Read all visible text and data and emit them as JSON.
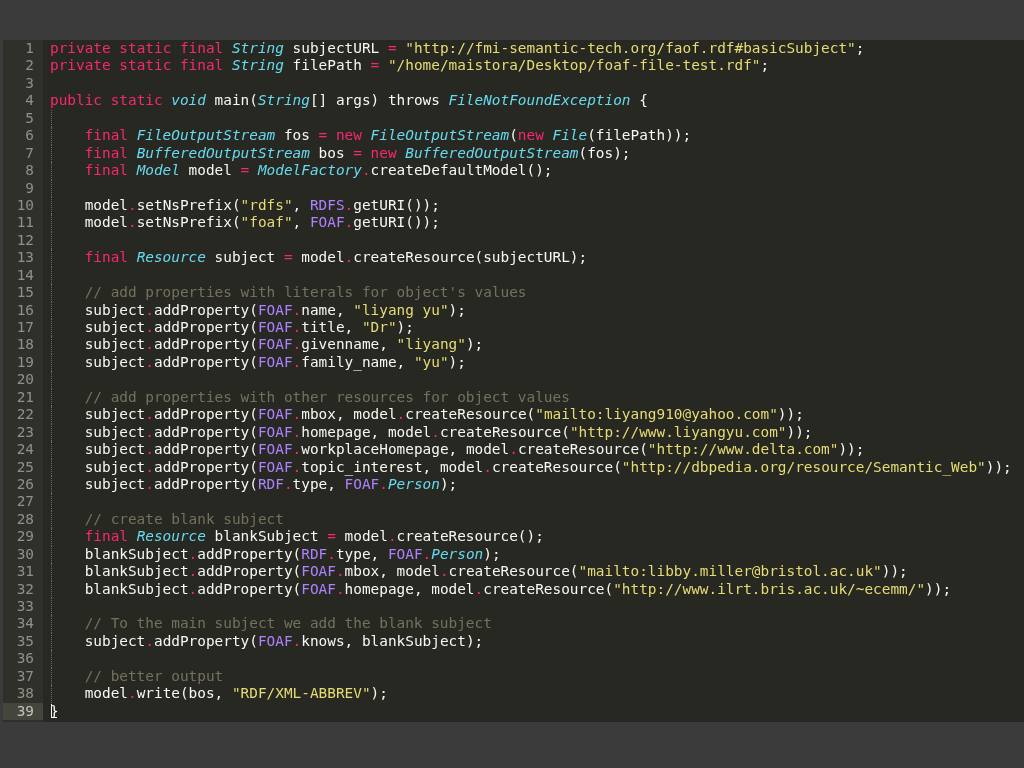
{
  "editor": {
    "lines": [
      {
        "number": "1",
        "indented": false,
        "current": false,
        "tokens": [
          {
            "kind": "keyword",
            "text": "private static final "
          },
          {
            "kind": "type",
            "text": "String"
          },
          {
            "kind": "plain",
            "text": " subjectURL "
          },
          {
            "kind": "operator",
            "text": "= "
          },
          {
            "kind": "string",
            "text": "\"http://fmi-semantic-tech.org/faof.rdf#basicSubject\""
          },
          {
            "kind": "plain",
            "text": ";"
          }
        ]
      },
      {
        "number": "2",
        "indented": false,
        "current": false,
        "tokens": [
          {
            "kind": "keyword",
            "text": "private static final "
          },
          {
            "kind": "type",
            "text": "String"
          },
          {
            "kind": "plain",
            "text": " filePath "
          },
          {
            "kind": "operator",
            "text": "= "
          },
          {
            "kind": "string",
            "text": "\"/home/maistora/Desktop/foaf-file-test.rdf\""
          },
          {
            "kind": "plain",
            "text": ";"
          }
        ]
      },
      {
        "number": "3",
        "indented": false,
        "current": false
      },
      {
        "number": "4",
        "indented": false,
        "current": false,
        "tokens": [
          {
            "kind": "keyword",
            "text": "public static "
          },
          {
            "kind": "type",
            "text": "void"
          },
          {
            "kind": "plain",
            "text": " main("
          },
          {
            "kind": "type",
            "text": "String"
          },
          {
            "kind": "plain",
            "text": "[] args) throws "
          },
          {
            "kind": "type",
            "text": "FileNotFoundException"
          },
          {
            "kind": "plain",
            "text": " {"
          }
        ]
      },
      {
        "number": "5",
        "indented": true,
        "current": false
      },
      {
        "number": "6",
        "indented": true,
        "current": false,
        "tokens": [
          {
            "kind": "keyword",
            "text": "final "
          },
          {
            "kind": "type",
            "text": "FileOutputStream"
          },
          {
            "kind": "plain",
            "text": " fos "
          },
          {
            "kind": "operator",
            "text": "= "
          },
          {
            "kind": "keyword",
            "text": "new "
          },
          {
            "kind": "type",
            "text": "FileOutputStream"
          },
          {
            "kind": "plain",
            "text": "("
          },
          {
            "kind": "keyword",
            "text": "new "
          },
          {
            "kind": "type",
            "text": "File"
          },
          {
            "kind": "plain",
            "text": "(filePath));"
          }
        ]
      },
      {
        "number": "7",
        "indented": true,
        "current": false,
        "tokens": [
          {
            "kind": "keyword",
            "text": "final "
          },
          {
            "kind": "type",
            "text": "BufferedOutputStream"
          },
          {
            "kind": "plain",
            "text": " bos "
          },
          {
            "kind": "operator",
            "text": "= "
          },
          {
            "kind": "keyword",
            "text": "new "
          },
          {
            "kind": "type",
            "text": "BufferedOutputStream"
          },
          {
            "kind": "plain",
            "text": "(fos);"
          }
        ]
      },
      {
        "number": "8",
        "indented": true,
        "current": false,
        "tokens": [
          {
            "kind": "keyword",
            "text": "final "
          },
          {
            "kind": "type",
            "text": "Model"
          },
          {
            "kind": "plain",
            "text": " model "
          },
          {
            "kind": "operator",
            "text": "= "
          },
          {
            "kind": "type",
            "text": "ModelFactory"
          },
          {
            "kind": "operator",
            "text": "."
          },
          {
            "kind": "plain",
            "text": "createDefaultModel();"
          }
        ]
      },
      {
        "number": "9",
        "indented": true,
        "current": false
      },
      {
        "number": "10",
        "indented": true,
        "current": false,
        "tokens": [
          {
            "kind": "plain",
            "text": "model"
          },
          {
            "kind": "operator",
            "text": "."
          },
          {
            "kind": "plain",
            "text": "setNsPrefix("
          },
          {
            "kind": "string",
            "text": "\"rdfs\""
          },
          {
            "kind": "plain",
            "text": ", "
          },
          {
            "kind": "constant",
            "text": "RDFS"
          },
          {
            "kind": "operator",
            "text": "."
          },
          {
            "kind": "plain",
            "text": "getURI());"
          }
        ]
      },
      {
        "number": "11",
        "indented": true,
        "current": false,
        "tokens": [
          {
            "kind": "plain",
            "text": "model"
          },
          {
            "kind": "operator",
            "text": "."
          },
          {
            "kind": "plain",
            "text": "setNsPrefix("
          },
          {
            "kind": "string",
            "text": "\"foaf\""
          },
          {
            "kind": "plain",
            "text": ", "
          },
          {
            "kind": "constant",
            "text": "FOAF"
          },
          {
            "kind": "operator",
            "text": "."
          },
          {
            "kind": "plain",
            "text": "getURI());"
          }
        ]
      },
      {
        "number": "12",
        "indented": true,
        "current": false
      },
      {
        "number": "13",
        "indented": true,
        "current": false,
        "tokens": [
          {
            "kind": "keyword",
            "text": "final "
          },
          {
            "kind": "type",
            "text": "Resource"
          },
          {
            "kind": "plain",
            "text": " subject "
          },
          {
            "kind": "operator",
            "text": "="
          },
          {
            "kind": "plain",
            "text": " model"
          },
          {
            "kind": "operator",
            "text": "."
          },
          {
            "kind": "plain",
            "text": "createResource(subjectURL);"
          }
        ]
      },
      {
        "number": "14",
        "indented": true,
        "current": false
      },
      {
        "number": "15",
        "indented": true,
        "current": false,
        "tokens": [
          {
            "kind": "comment",
            "text": "// add properties with literals for object's values"
          }
        ]
      },
      {
        "number": "16",
        "indented": true,
        "current": false,
        "tokens": [
          {
            "kind": "plain",
            "text": "subject"
          },
          {
            "kind": "operator",
            "text": "."
          },
          {
            "kind": "plain",
            "text": "addProperty("
          },
          {
            "kind": "constant",
            "text": "FOAF"
          },
          {
            "kind": "operator",
            "text": "."
          },
          {
            "kind": "plain",
            "text": "name, "
          },
          {
            "kind": "string",
            "text": "\"liyang yu\""
          },
          {
            "kind": "plain",
            "text": ");"
          }
        ]
      },
      {
        "number": "17",
        "indented": true,
        "current": false,
        "tokens": [
          {
            "kind": "plain",
            "text": "subject"
          },
          {
            "kind": "operator",
            "text": "."
          },
          {
            "kind": "plain",
            "text": "addProperty("
          },
          {
            "kind": "constant",
            "text": "FOAF"
          },
          {
            "kind": "operator",
            "text": "."
          },
          {
            "kind": "plain",
            "text": "title, "
          },
          {
            "kind": "string",
            "text": "\"Dr\""
          },
          {
            "kind": "plain",
            "text": ");"
          }
        ]
      },
      {
        "number": "18",
        "indented": true,
        "current": false,
        "tokens": [
          {
            "kind": "plain",
            "text": "subject"
          },
          {
            "kind": "operator",
            "text": "."
          },
          {
            "kind": "plain",
            "text": "addProperty("
          },
          {
            "kind": "constant",
            "text": "FOAF"
          },
          {
            "kind": "operator",
            "text": "."
          },
          {
            "kind": "plain",
            "text": "givenname, "
          },
          {
            "kind": "string",
            "text": "\"liyang\""
          },
          {
            "kind": "plain",
            "text": ");"
          }
        ]
      },
      {
        "number": "19",
        "indented": true,
        "current": false,
        "tokens": [
          {
            "kind": "plain",
            "text": "subject"
          },
          {
            "kind": "operator",
            "text": "."
          },
          {
            "kind": "plain",
            "text": "addProperty("
          },
          {
            "kind": "constant",
            "text": "FOAF"
          },
          {
            "kind": "operator",
            "text": "."
          },
          {
            "kind": "plain",
            "text": "family_name, "
          },
          {
            "kind": "string",
            "text": "\"yu\""
          },
          {
            "kind": "plain",
            "text": ");"
          }
        ]
      },
      {
        "number": "20",
        "indented": true,
        "current": false
      },
      {
        "number": "21",
        "indented": true,
        "current": false,
        "tokens": [
          {
            "kind": "comment",
            "text": "// add properties with other resources for object values"
          }
        ]
      },
      {
        "number": "22",
        "indented": true,
        "current": false,
        "tokens": [
          {
            "kind": "plain",
            "text": "subject"
          },
          {
            "kind": "operator",
            "text": "."
          },
          {
            "kind": "plain",
            "text": "addProperty("
          },
          {
            "kind": "constant",
            "text": "FOAF"
          },
          {
            "kind": "operator",
            "text": "."
          },
          {
            "kind": "plain",
            "text": "mbox, model"
          },
          {
            "kind": "operator",
            "text": "."
          },
          {
            "kind": "plain",
            "text": "createResource("
          },
          {
            "kind": "string",
            "text": "\"mailto:liyang910@yahoo.com\""
          },
          {
            "kind": "plain",
            "text": "));"
          }
        ]
      },
      {
        "number": "23",
        "indented": true,
        "current": false,
        "tokens": [
          {
            "kind": "plain",
            "text": "subject"
          },
          {
            "kind": "operator",
            "text": "."
          },
          {
            "kind": "plain",
            "text": "addProperty("
          },
          {
            "kind": "constant",
            "text": "FOAF"
          },
          {
            "kind": "operator",
            "text": "."
          },
          {
            "kind": "plain",
            "text": "homepage, model"
          },
          {
            "kind": "operator",
            "text": "."
          },
          {
            "kind": "plain",
            "text": "createResource("
          },
          {
            "kind": "string",
            "text": "\"http://www.liyangyu.com\""
          },
          {
            "kind": "plain",
            "text": "));"
          }
        ]
      },
      {
        "number": "24",
        "indented": true,
        "current": false,
        "tokens": [
          {
            "kind": "plain",
            "text": "subject"
          },
          {
            "kind": "operator",
            "text": "."
          },
          {
            "kind": "plain",
            "text": "addProperty("
          },
          {
            "kind": "constant",
            "text": "FOAF"
          },
          {
            "kind": "operator",
            "text": "."
          },
          {
            "kind": "plain",
            "text": "workplaceHomepage, model"
          },
          {
            "kind": "operator",
            "text": "."
          },
          {
            "kind": "plain",
            "text": "createResource("
          },
          {
            "kind": "string",
            "text": "\"http://www.delta.com\""
          },
          {
            "kind": "plain",
            "text": "));"
          }
        ]
      },
      {
        "number": "25",
        "indented": true,
        "current": false,
        "tokens": [
          {
            "kind": "plain",
            "text": "subject"
          },
          {
            "kind": "operator",
            "text": "."
          },
          {
            "kind": "plain",
            "text": "addProperty("
          },
          {
            "kind": "constant",
            "text": "FOAF"
          },
          {
            "kind": "operator",
            "text": "."
          },
          {
            "kind": "plain",
            "text": "topic_interest, model"
          },
          {
            "kind": "operator",
            "text": "."
          },
          {
            "kind": "plain",
            "text": "createResource("
          },
          {
            "kind": "string",
            "text": "\"http://dbpedia.org/resource/Semantic_Web\""
          },
          {
            "kind": "plain",
            "text": "));"
          }
        ]
      },
      {
        "number": "26",
        "indented": true,
        "current": false,
        "tokens": [
          {
            "kind": "plain",
            "text": "subject"
          },
          {
            "kind": "operator",
            "text": "."
          },
          {
            "kind": "plain",
            "text": "addProperty("
          },
          {
            "kind": "constant",
            "text": "RDF"
          },
          {
            "kind": "operator",
            "text": "."
          },
          {
            "kind": "plain",
            "text": "type, "
          },
          {
            "kind": "constant",
            "text": "FOAF"
          },
          {
            "kind": "operator",
            "text": "."
          },
          {
            "kind": "type",
            "text": "Person"
          },
          {
            "kind": "plain",
            "text": ");"
          }
        ]
      },
      {
        "number": "27",
        "indented": true,
        "current": false
      },
      {
        "number": "28",
        "indented": true,
        "current": false,
        "tokens": [
          {
            "kind": "comment",
            "text": "// create blank subject"
          }
        ]
      },
      {
        "number": "29",
        "indented": true,
        "current": false,
        "tokens": [
          {
            "kind": "keyword",
            "text": "final "
          },
          {
            "kind": "type",
            "text": "Resource"
          },
          {
            "kind": "plain",
            "text": " blankSubject "
          },
          {
            "kind": "operator",
            "text": "="
          },
          {
            "kind": "plain",
            "text": " model"
          },
          {
            "kind": "operator",
            "text": "."
          },
          {
            "kind": "plain",
            "text": "createResource();"
          }
        ]
      },
      {
        "number": "30",
        "indented": true,
        "current": false,
        "tokens": [
          {
            "kind": "plain",
            "text": "blankSubject"
          },
          {
            "kind": "operator",
            "text": "."
          },
          {
            "kind": "plain",
            "text": "addProperty("
          },
          {
            "kind": "constant",
            "text": "RDF"
          },
          {
            "kind": "operator",
            "text": "."
          },
          {
            "kind": "plain",
            "text": "type, "
          },
          {
            "kind": "constant",
            "text": "FOAF"
          },
          {
            "kind": "operator",
            "text": "."
          },
          {
            "kind": "type",
            "text": "Person"
          },
          {
            "kind": "plain",
            "text": ");"
          }
        ]
      },
      {
        "number": "31",
        "indented": true,
        "current": false,
        "tokens": [
          {
            "kind": "plain",
            "text": "blankSubject"
          },
          {
            "kind": "operator",
            "text": "."
          },
          {
            "kind": "plain",
            "text": "addProperty("
          },
          {
            "kind": "constant",
            "text": "FOAF"
          },
          {
            "kind": "operator",
            "text": "."
          },
          {
            "kind": "plain",
            "text": "mbox, model"
          },
          {
            "kind": "operator",
            "text": "."
          },
          {
            "kind": "plain",
            "text": "createResource("
          },
          {
            "kind": "string",
            "text": "\"mailto:libby.miller@bristol.ac.uk\""
          },
          {
            "kind": "plain",
            "text": "));"
          }
        ]
      },
      {
        "number": "32",
        "indented": true,
        "current": false,
        "tokens": [
          {
            "kind": "plain",
            "text": "blankSubject"
          },
          {
            "kind": "operator",
            "text": "."
          },
          {
            "kind": "plain",
            "text": "addProperty("
          },
          {
            "kind": "constant",
            "text": "FOAF"
          },
          {
            "kind": "operator",
            "text": "."
          },
          {
            "kind": "plain",
            "text": "homepage, model"
          },
          {
            "kind": "operator",
            "text": "."
          },
          {
            "kind": "plain",
            "text": "createResource("
          },
          {
            "kind": "string",
            "text": "\"http://www.ilrt.bris.ac.uk/~ecemm/\""
          },
          {
            "kind": "plain",
            "text": "));"
          }
        ]
      },
      {
        "number": "33",
        "indented": true,
        "current": false
      },
      {
        "number": "34",
        "indented": true,
        "current": false,
        "tokens": [
          {
            "kind": "comment",
            "text": "// To the main subject we add the blank subject"
          }
        ]
      },
      {
        "number": "35",
        "indented": true,
        "current": false,
        "tokens": [
          {
            "kind": "plain",
            "text": "subject"
          },
          {
            "kind": "operator",
            "text": "."
          },
          {
            "kind": "plain",
            "text": "addProperty("
          },
          {
            "kind": "constant",
            "text": "FOAF"
          },
          {
            "kind": "operator",
            "text": "."
          },
          {
            "kind": "plain",
            "text": "knows, blankSubject);"
          }
        ]
      },
      {
        "number": "36",
        "indented": true,
        "current": false
      },
      {
        "number": "37",
        "indented": true,
        "current": false,
        "tokens": [
          {
            "kind": "comment",
            "text": "// better output"
          }
        ]
      },
      {
        "number": "38",
        "indented": true,
        "current": false,
        "tokens": [
          {
            "kind": "plain",
            "text": "model"
          },
          {
            "kind": "operator",
            "text": "."
          },
          {
            "kind": "plain",
            "text": "write(bos, "
          },
          {
            "kind": "string",
            "text": "\"RDF/XML-ABBREV\""
          },
          {
            "kind": "plain",
            "text": ");"
          }
        ]
      },
      {
        "number": "39",
        "indented": false,
        "current": true,
        "tokens": [
          {
            "kind": "plain",
            "text": "}"
          }
        ]
      }
    ]
  }
}
